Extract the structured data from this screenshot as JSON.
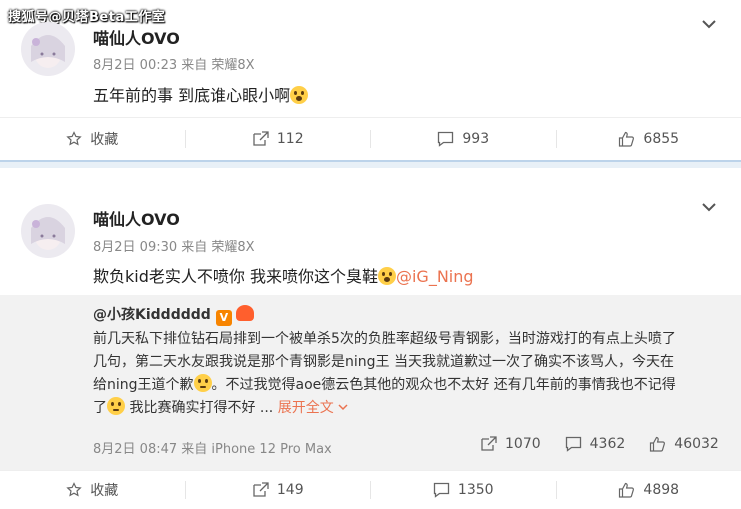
{
  "watermark": "搜狐号@贝塔Beta工作室",
  "posts": [
    {
      "author": "喵仙人OVO",
      "meta": "8月2日 00:23 来自 荣耀8X",
      "text": "五年前的事 到底谁心眼小啊",
      "actions": {
        "fav": "收藏",
        "repost": "112",
        "comment": "993",
        "like": "6855"
      }
    },
    {
      "author": "喵仙人OVO",
      "meta": "8月2日 09:30 来自 荣耀8X",
      "text": "欺负kid老实人不喷你 我来喷你这个臭鞋",
      "mention": "@iG_Ning",
      "quote": {
        "author": "@小孩Kidddddd",
        "line1": "前几天私下排位钻石局排到一个被单杀5次的负胜率超级号青钢影，当时游戏打的有点上头喷了",
        "line2": "几句，第二天水友跟我说是那个青钢影是ning王 当天我就道歉过一次了确实不该骂人，今天在",
        "line3a": "给ning王道个歉",
        "line3b": "。不过我觉得aoe德云色其他的观众也不太好 还有几年前的事情我也不记得",
        "line4a": "了",
        "line4b": " 我比赛确实打得不好 ...",
        "expand": "展开全文",
        "meta": "8月2日 08:47 来自 iPhone 12 Pro Max",
        "actions": {
          "repost": "1070",
          "comment": "4362",
          "like": "46032"
        }
      },
      "actions": {
        "fav": "收藏",
        "repost": "149",
        "comment": "1350",
        "like": "4898"
      }
    }
  ]
}
